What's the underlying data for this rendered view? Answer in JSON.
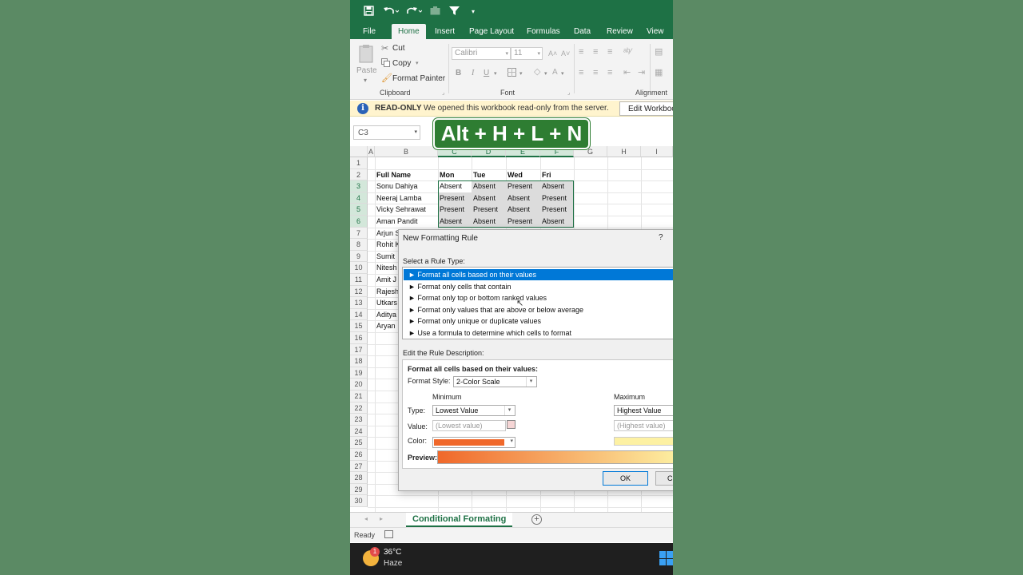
{
  "titlebar": {
    "qa_icons": [
      "save-icon",
      "undo-icon",
      "redo-icon",
      "camera-icon",
      "filter-icon",
      "customize-icon"
    ]
  },
  "tabs": [
    "File",
    "Home",
    "Insert",
    "Page Layout",
    "Formulas",
    "Data",
    "Review",
    "View"
  ],
  "ribbon": {
    "paste": "Paste",
    "cut": "Cut",
    "copy": "Copy",
    "format_painter": "Format Painter",
    "clipboard": "Clipboard",
    "font_name": "Calibri",
    "font_size": "11",
    "font": "Font",
    "alignment": "Alignment",
    "bold": "B",
    "italic": "I",
    "underline": "U"
  },
  "readonly_bar": {
    "icon": "i",
    "title": "READ-ONLY",
    "message": "We opened this workbook read-only from the server.",
    "button": "Edit Workbook"
  },
  "namebox": "C3",
  "shortcut": "Alt + H + L + N",
  "grid": {
    "columns": [
      "A",
      "B",
      "C",
      "D",
      "E",
      "F",
      "G",
      "H",
      "I"
    ],
    "rows": [
      "1",
      "2",
      "3",
      "4",
      "5",
      "6",
      "7",
      "8",
      "9",
      "10",
      "11",
      "12",
      "13",
      "14",
      "15",
      "16",
      "17",
      "18",
      "19",
      "20",
      "21",
      "22",
      "23",
      "24",
      "25",
      "26",
      "27",
      "28",
      "29",
      "30"
    ],
    "headers": [
      "Full Name",
      "Mon",
      "Tue",
      "Wed",
      "Fri"
    ],
    "data": [
      [
        "Sonu Dahiya",
        "Absent",
        "Absent",
        "Present",
        "Absent"
      ],
      [
        "Neeraj Lamba",
        "Present",
        "Absent",
        "Absent",
        "Present"
      ],
      [
        "Vicky Sehrawat",
        "Present",
        "Present",
        "Absent",
        "Present"
      ],
      [
        "Aman Pandit",
        "Absent",
        "Absent",
        "Present",
        "Absent"
      ]
    ],
    "partial_names": [
      "Arjun S",
      "Rohit K",
      "Sumit",
      "Nitesh",
      "Amit J",
      "Rajesh",
      "Utkars",
      "Aditya",
      "Aryan"
    ]
  },
  "sheet": {
    "name": "Conditional Formating",
    "add": "+"
  },
  "status": {
    "text": "Ready"
  },
  "taskbar": {
    "badge": "1",
    "temp": "36°C",
    "condition": "Haze"
  },
  "dialog": {
    "title": "New Formatting Rule",
    "help": "?",
    "select_label": "Select a Rule Type:",
    "rules": [
      "► Format all cells based on their values",
      "► Format only cells that contain",
      "► Format only top or bottom ranked values",
      "► Format only values that are above or below average",
      "► Format only unique or duplicate values",
      "► Use a formula to determine which cells to format"
    ],
    "edit_label": "Edit the Rule Description:",
    "desc_title": "Format all cells based on their values:",
    "format_style_label": "Format Style:",
    "format_style": "2-Color Scale",
    "minimum": "Minimum",
    "maximum": "Maximum",
    "type_label": "Type:",
    "min_type": "Lowest Value",
    "max_type": "Highest Value",
    "value_label": "Value:",
    "min_value": "(Lowest value)",
    "max_value": "(Highest value)",
    "color_label": "Color:",
    "preview_label": "Preview:",
    "ok": "OK",
    "cancel": "C"
  },
  "colors": {
    "excel_green": "#1e7145",
    "min_color": "#f0682a",
    "max_color": "#fdf1a3",
    "selection_blue": "#0078d7"
  }
}
